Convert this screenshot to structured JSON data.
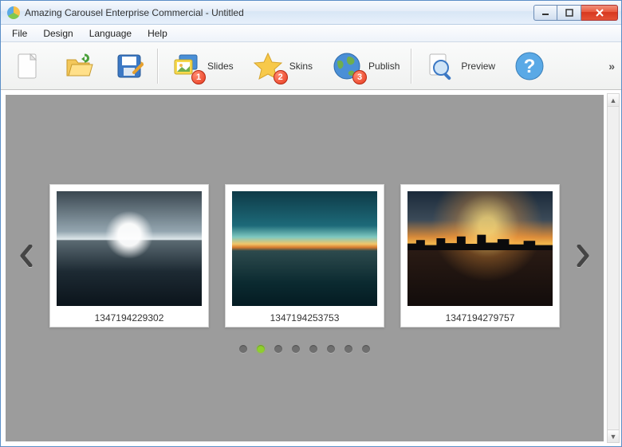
{
  "window": {
    "title": "Amazing Carousel Enterprise Commercial - Untitled"
  },
  "menu": {
    "items": [
      "File",
      "Design",
      "Language",
      "Help"
    ]
  },
  "toolbar": {
    "new": "",
    "open": "",
    "save": "",
    "slides": {
      "label": "Slides",
      "badge": "1"
    },
    "skins": {
      "label": "Skins",
      "badge": "2"
    },
    "publish": {
      "label": "Publish",
      "badge": "3"
    },
    "preview": {
      "label": "Preview"
    },
    "help": "",
    "more": "»"
  },
  "carousel": {
    "slides": [
      {
        "caption": "1347194229302"
      },
      {
        "caption": "1347194253753"
      },
      {
        "caption": "1347194279757"
      }
    ],
    "dot_count": 8,
    "active_dot_index": 1
  }
}
